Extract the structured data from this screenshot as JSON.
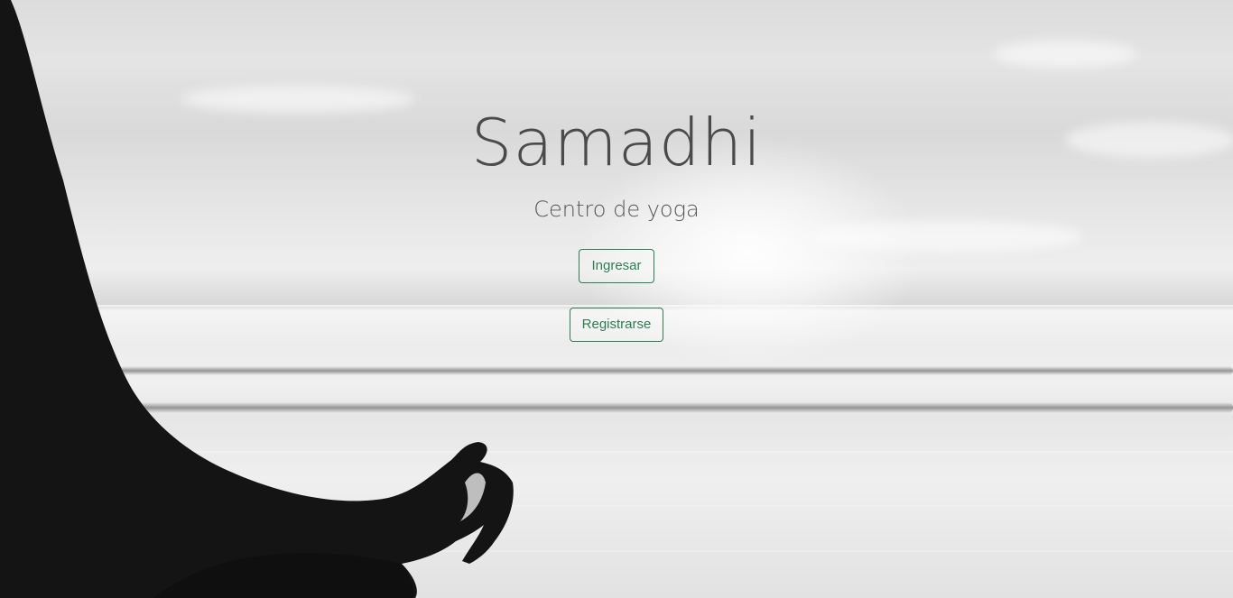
{
  "brand": {
    "title": "Samadhi",
    "subtitle": "Centro de yoga"
  },
  "actions": {
    "login_label": "Ingresar",
    "register_label": "Registrarse"
  },
  "colors": {
    "accent": "#2e7d52",
    "title_text": "#4a4a4a"
  },
  "background": {
    "image_icon": "meditation-photo-grayscale"
  }
}
